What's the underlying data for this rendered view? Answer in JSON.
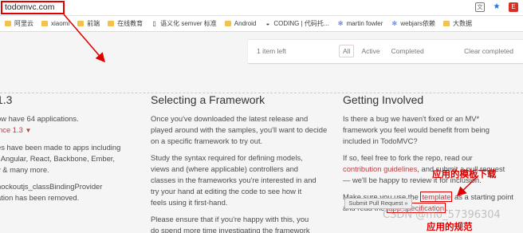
{
  "browser": {
    "url": "todomvc.com",
    "bookmarks": [
      {
        "label": "阿里云",
        "icon": "folder"
      },
      {
        "label": "xiaomi",
        "icon": "folder"
      },
      {
        "label": "前端",
        "icon": "folder"
      },
      {
        "label": "在线教育",
        "icon": "folder"
      },
      {
        "label": "语义化 semver 标准",
        "icon": "page"
      },
      {
        "label": "Android",
        "icon": "folder"
      },
      {
        "label": "CODING | 代码托...",
        "icon": "coding"
      },
      {
        "label": "martin fowler",
        "icon": "gear"
      },
      {
        "label": "webjars依赖",
        "icon": "gear"
      },
      {
        "label": "大数据",
        "icon": "folder"
      }
    ]
  },
  "todo_footer": {
    "count": "1 item left",
    "filters": [
      "All",
      "Active",
      "Completed"
    ],
    "selected_filter": "All",
    "clear": "Clear completed"
  },
  "col1": {
    "heading": "1.3",
    "line1": "ow have 64 applications.",
    "since": "ince 1.3",
    "line2a": "es have been made to apps including",
    "line2b": ", Angular, React, Backbone, Ember,",
    "line2c": "y & many more.",
    "line3a": "hockoutjs_classBindingProvider",
    "line3b": "ation has been removed."
  },
  "col2": {
    "heading": "Selecting a Framework",
    "p1": [
      "Once you've downloaded the latest release and",
      "played around with the samples, you'll want to decide",
      "on a specific framework to try out."
    ],
    "p2": [
      "Study the syntax required for defining models,",
      "views and (where applicable) controllers and",
      "classes in the frameworks you're interested in and",
      "try your hand at editing the code to see how it",
      "feels using it first-hand."
    ],
    "p3": [
      "Please ensure that if you're happy with this, you",
      "do spend more time investigating the framework"
    ]
  },
  "col3": {
    "heading": "Getting Involved",
    "p1": [
      "Is there a bug we haven't fixed or an MV*",
      "framework you feel would benefit from being",
      "included in TodoMVC?"
    ],
    "p2_line1": "If so, feel free to fork the repo, read our",
    "p2_link": "contribution guidelines",
    "p2_line2_rest": ", and submit a pull request",
    "p2_line3": "— we'll be happy to review it for inclusion.",
    "p3_a": "Make sure you use the ",
    "p3_link1": "template",
    "p3_b": " as a starting point",
    "p3_c": "and read the ",
    "p3_link2": "app specification",
    "p3_d": ".",
    "button": "Submit Pull Request »"
  },
  "annotations": {
    "template_note": "应用的模板下载",
    "spec_note": "应用的规范",
    "watermark": "CSDN @m0_57396304"
  },
  "colors": {
    "accent": "#b83f45",
    "annotation_red": "#e00000"
  }
}
